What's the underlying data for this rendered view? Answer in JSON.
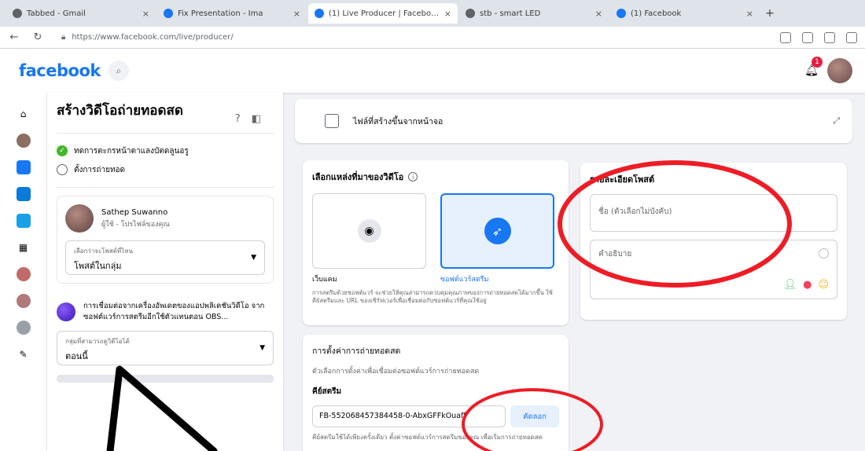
{
  "browser": {
    "tabs": [
      {
        "label": "Tabbed - Gmail",
        "active": false
      },
      {
        "label": "Fix Presentation - Ima",
        "active": false
      },
      {
        "label": "(1) Live Producer | Facebook",
        "active": true
      },
      {
        "label": "stb - smart LED",
        "active": false
      },
      {
        "label": "(1) Facebook",
        "active": false
      }
    ],
    "new_tab": "+",
    "url": "https://www.facebook.com/live/producer/"
  },
  "facebook": {
    "logo": "facebook",
    "notifications_count": "1"
  },
  "left_panel": {
    "title": "สร้างวิดีโอถ่ายทอดสด",
    "steps": [
      {
        "label": "ทดการตะกรหน้าตาแลงบัตดลูนอรู",
        "done": true
      },
      {
        "label": "ตั้งการถ่ายทอด",
        "done": false
      }
    ],
    "user": {
      "name": "Sathep Suwanno",
      "subtitle": "ผู้ใช้ - โปรไฟล์ของคุณ"
    },
    "post_where": {
      "label": "เลือกว่าจะโพสต์ที่ไหน",
      "value": "โพสต์ในกลุ่ม"
    },
    "source_text": "การเชื่อมต่อจากเครื่องอัพเดตของแอปพลิเคชันวิดีโอ จากซอฟต์แวร์การสตรีมอีกใช้ตัวแทนตอน OBS...",
    "audience": {
      "label": "กลุ่มที่สามารถดูวิดีโอได้",
      "value": "ตอนนี้"
    }
  },
  "main": {
    "topbar_text": "ไฟล์ที่สร้างขึ้นจากหน้าจอ",
    "video_source": {
      "title": "เลือกแหล่งที่มาของวิดีโอ",
      "options": [
        {
          "label": "เว็บแคม",
          "selected": false
        },
        {
          "label": "ซอฟต์แวร์สตรีม",
          "selected": true
        }
      ],
      "fine_print": "การสตรีมด้วยซอฟต์แวร์ จะช่วยให้คุณสามารถควบคุมคุณภาพของการถ่ายทอดสดได้มากขึ้น ใช้คีย์สตรีมและ URL ของเซิร์ฟเวอร์เพื่อเชื่อมต่อกับซอฟต์แวร์ที่คุณใช้อยู่"
    },
    "post_details": {
      "title": "รายละเอียดโพสต์",
      "title_placeholder": "ชื่อ (ตัวเลือกไม่บังคับ)",
      "description_placeholder": "คำอธิบาย"
    },
    "stream_setup": {
      "title": "การตั้งค่าการถ่ายทอดสด",
      "subtitle": "ตัวเลือกการตั้งค่าเพื่อเชื่อมต่อซอฟต์แวร์การถ่ายทอดสด",
      "key_label": "คีย์สตรีม",
      "stream_key": "FB-552068457384458-0-AbxGFFkOuaff",
      "copy_label": "คัดลอก",
      "footer": "คีย์สตรีมใช้ได้เพียงครั้งเดียว ตั้งค่าซอฟต์แวร์การสตรีมของคุณ เพื่อเริ่มการถ่ายทอดสด"
    }
  },
  "colors": {
    "brand": "#1877f2",
    "annotation": "#ee1c25"
  }
}
